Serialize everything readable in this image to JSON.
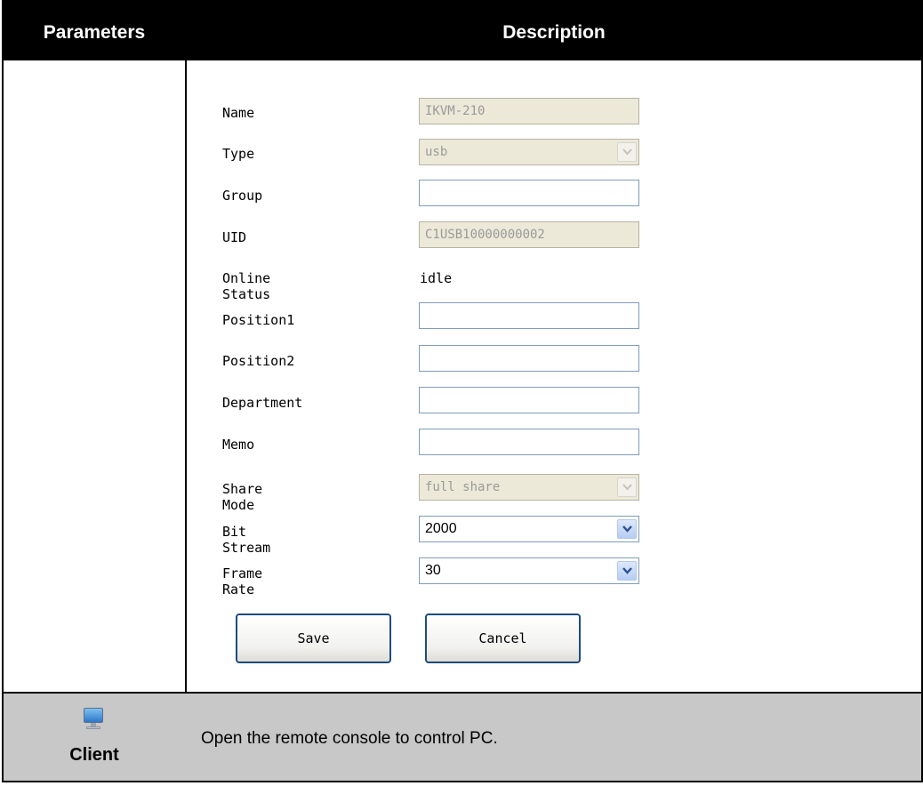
{
  "table": {
    "header": {
      "parameters": "Parameters",
      "description": "Description"
    }
  },
  "form": {
    "name": {
      "label": "Name",
      "value": "IKVM-210"
    },
    "type": {
      "label": "Type",
      "value": "usb"
    },
    "group": {
      "label": "Group",
      "value": ""
    },
    "uid": {
      "label": "UID",
      "value": "C1USB10000000002"
    },
    "online_status": {
      "label": "Online Status",
      "value": "idle"
    },
    "position1": {
      "label": "Position1",
      "value": ""
    },
    "position2": {
      "label": "Position2",
      "value": ""
    },
    "department": {
      "label": "Department",
      "value": ""
    },
    "memo": {
      "label": "Memo",
      "value": ""
    },
    "share_mode": {
      "label": "Share Mode",
      "value": "full share"
    },
    "bit_stream": {
      "label": "Bit Stream",
      "value": "2000"
    },
    "frame_rate": {
      "label": "Frame Rate",
      "value": "30"
    },
    "save_label": "Save",
    "cancel_label": "Cancel"
  },
  "client_row": {
    "icon": "monitor-icon",
    "name": "Client",
    "description": "Open the remote console to control PC."
  },
  "colors": {
    "header_bg": "#000000",
    "header_text": "#ffffff",
    "client_row_bg": "#c8c8c8",
    "disabled_field_bg": "#ece9d8",
    "button_border": "#1d4d7d"
  }
}
